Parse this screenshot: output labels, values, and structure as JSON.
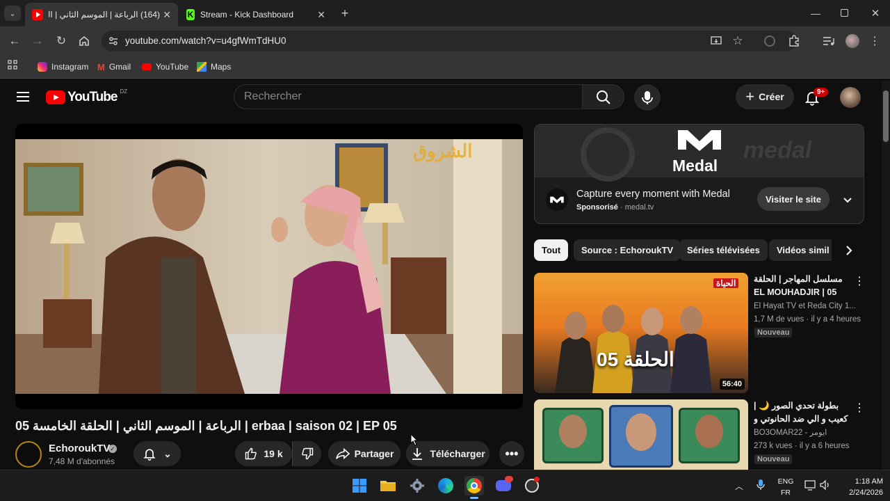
{
  "browser": {
    "tabs": [
      {
        "title": "(164) الرباعة | الموسم الثاني | الح"
      },
      {
        "title": "Stream - Kick Dashboard"
      }
    ],
    "address": "youtube.com/watch?v=u4gfWmTdHU0",
    "bookmarks": [
      "Instagram",
      "Gmail",
      "YouTube",
      "Maps"
    ]
  },
  "youtube": {
    "logo_text": "YouTube",
    "region": "DZ",
    "search_placeholder": "Rechercher",
    "create_label": "Créer",
    "notif_count": "9+",
    "video": {
      "watermark": "الشروق",
      "title": "الرباعة | الموسم الثاني | الحلقة الخامسة 05 | erbaa | saison 02 | EP 05",
      "channel": "EchoroukTV",
      "subscribers": "7,48 M d'abonnés",
      "likes": "19 k",
      "share_label": "Partager",
      "download_label": "Télécharger"
    },
    "ad": {
      "brand": "Medal",
      "headline": "Capture every moment with Medal",
      "sponsored": "Sponsorisé",
      "domain": "medal.tv",
      "cta": "Visiter le site"
    },
    "chips": [
      "Tout",
      "Source : EchoroukTV",
      "Séries télévisées",
      "Vidéos simil"
    ],
    "recommendations": [
      {
        "title": "مسلسل المهاجر | الحلقة 05 | EL MOUHADJIR EP05",
        "channel": "El Hayat TV et Reda City 1...",
        "meta": "1,7 M de vues · il y a 4 heures",
        "badge": "Nouveau",
        "duration": "56:40",
        "thumb_text": "الحلقة 05",
        "thumb_brand": "الحياة"
      },
      {
        "title": "بطولة تحدي الصور 🌙 | كعيب و الي ضد الحانوتي و مازاز",
        "channel": "BO3OMAR22 - ايومر",
        "meta": "273 k vues · il y a 6 heures",
        "badge": "Nouveau"
      }
    ]
  },
  "taskbar": {
    "lang1": "ENG",
    "lang2": "FR",
    "time": "1:18 AM",
    "date": "2/24/2026"
  },
  "colors": {
    "yt_red": "#ff0000",
    "bg": "#0f0f0f",
    "chrome_bar": "#353535"
  }
}
